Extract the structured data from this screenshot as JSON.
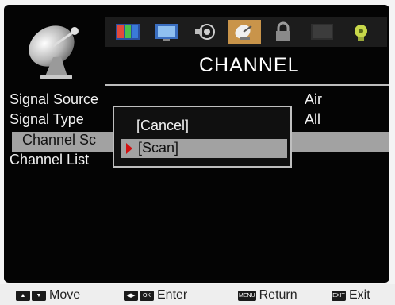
{
  "menu": {
    "title": "CHANNEL",
    "tabs": [
      {
        "icon": "picture-icon",
        "active": false
      },
      {
        "icon": "screen-icon",
        "active": false
      },
      {
        "icon": "sound-icon",
        "active": false
      },
      {
        "icon": "channel-icon",
        "active": true
      },
      {
        "icon": "lock-icon",
        "active": false
      },
      {
        "icon": "time-icon",
        "active": false
      },
      {
        "icon": "setup-icon",
        "active": false
      }
    ],
    "items": [
      {
        "label": "Signal Source",
        "value": "Air"
      },
      {
        "label": "Signal Type",
        "value": "All"
      },
      {
        "label": "Channel Sc",
        "value": "",
        "selected": true
      },
      {
        "label": "Channel List",
        "value": ""
      }
    ]
  },
  "popup": {
    "options": [
      {
        "label": "[Cancel]",
        "selected": false
      },
      {
        "label": "[Scan]",
        "selected": true
      }
    ]
  },
  "hints": {
    "move": {
      "keys": [
        "up-key",
        "down-key"
      ],
      "label": "Move"
    },
    "enter": {
      "keys": [
        "left-right-key",
        "OK"
      ],
      "label": "Enter"
    },
    "return": {
      "keys": [
        "MENU"
      ],
      "label": "Return"
    },
    "exit": {
      "keys": [
        "EXIT"
      ],
      "label": "Exit"
    }
  },
  "colors": {
    "highlight": "#a2a2a2",
    "active_tab": "#c9944a",
    "pointer": "#d21010"
  }
}
